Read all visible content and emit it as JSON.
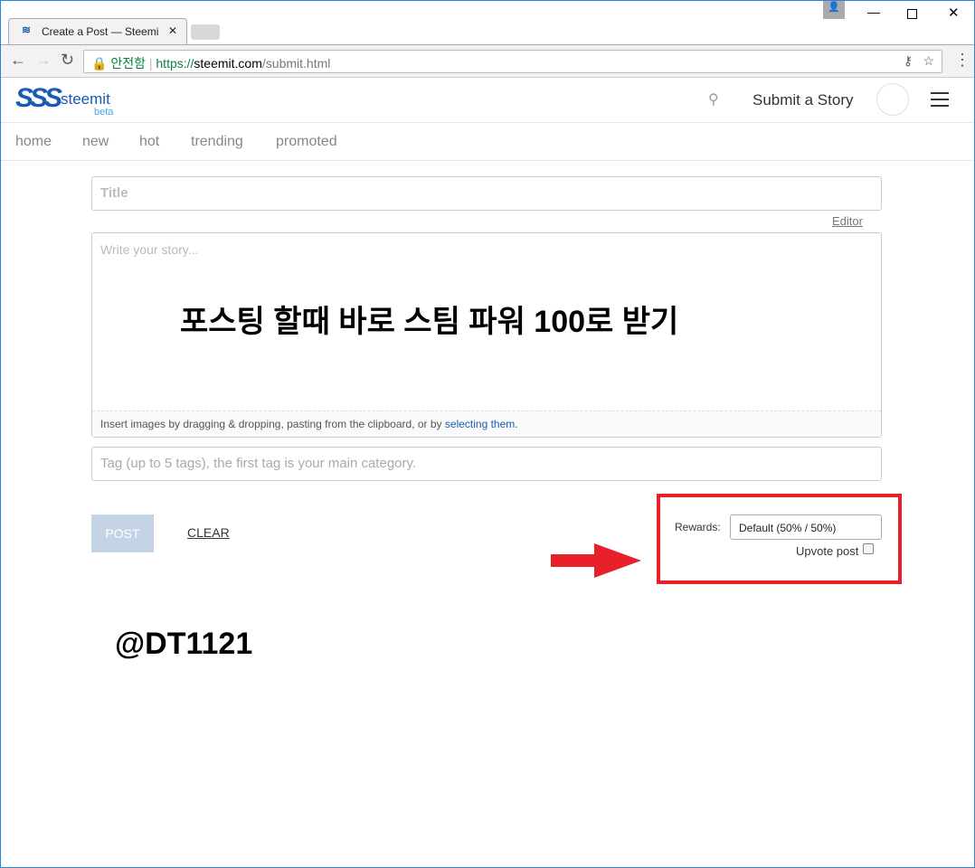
{
  "browser": {
    "tab_title": "Create a Post — Steemi",
    "security_label": "안전함",
    "url_scheme": "https://",
    "url_host": "steemit.com",
    "url_path": "/submit.html"
  },
  "header": {
    "brand": "steemit",
    "brand_sub": "beta",
    "submit_label": "Submit a Story"
  },
  "menu": {
    "items": [
      "home",
      "new",
      "hot",
      "trending",
      "promoted"
    ]
  },
  "editor": {
    "title_placeholder": "Title",
    "editor_link": "Editor",
    "body_placeholder": "Write your story...",
    "overlay_text": "포스팅 할때 바로 스팀 파워 100로 받기",
    "hint_prefix": "Insert images by dragging & dropping, pasting from the clipboard, or by ",
    "hint_link": "selecting them",
    "hint_suffix": ".",
    "tag_placeholder": "Tag (up to 5 tags), the first tag is your main category."
  },
  "actions": {
    "post_label": "POST",
    "clear_label": "CLEAR",
    "rewards_label": "Rewards:",
    "rewards_value": "Default (50% / 50%)",
    "upvote_label": "Upvote post",
    "upvote_checked": false
  },
  "annotation": {
    "username": "@DT1121",
    "highlight_color": "#e8202a"
  }
}
